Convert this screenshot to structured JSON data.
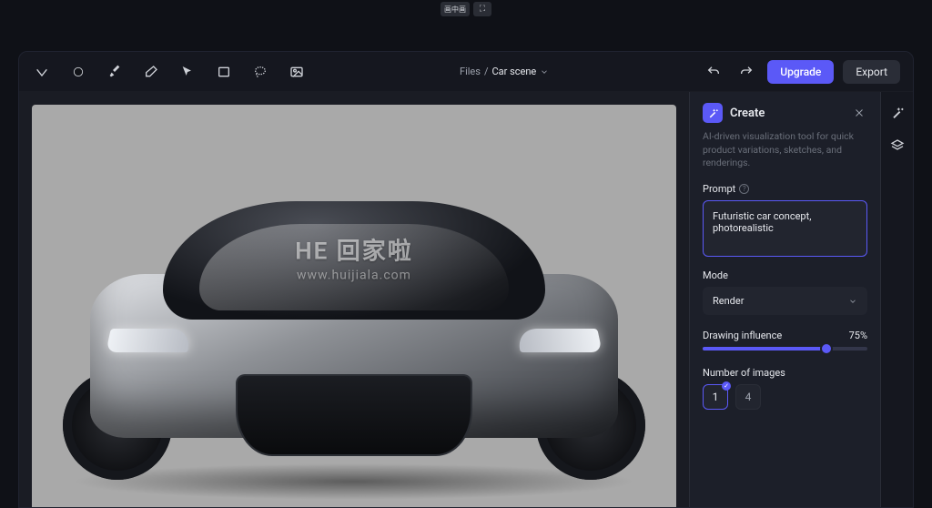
{
  "pip": {
    "btn1": "画中画",
    "btn2": "⛶"
  },
  "breadcrumb": {
    "root": "Files",
    "separator": "/",
    "current": "Car scene"
  },
  "topActions": {
    "upgrade": "Upgrade",
    "export": "Export"
  },
  "watermark": {
    "line1": "HE 回家啦",
    "line2": "www.huijiala.com"
  },
  "panel": {
    "title": "Create",
    "description": "AI-driven visualization tool for quick product variations, sketches, and renderings.",
    "promptLabel": "Prompt",
    "promptValue": "Futuristic car concept, photorealistic",
    "modeLabel": "Mode",
    "modeValue": "Render",
    "influenceLabel": "Drawing influence",
    "influenceValue": "75%",
    "numImagesLabel": "Number of images",
    "numOptions": {
      "opt1": "1",
      "opt4": "4"
    }
  }
}
